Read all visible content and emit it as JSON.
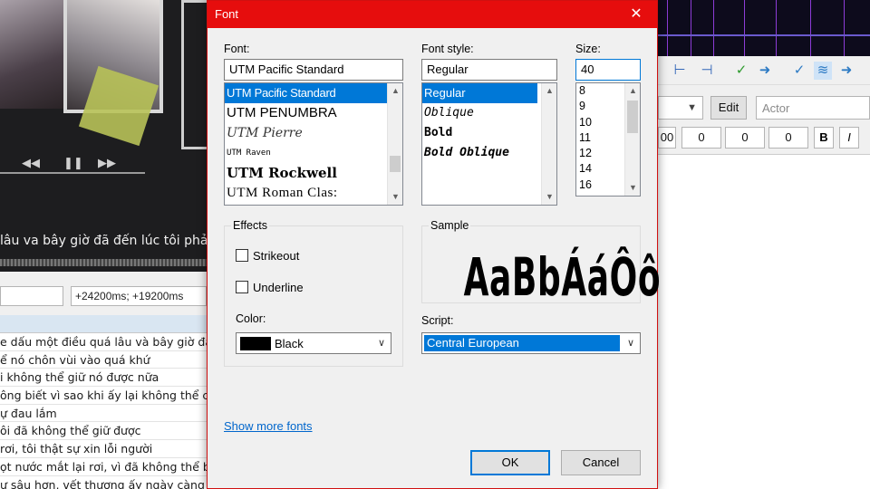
{
  "background": {
    "video_subtitle": "lâu va bây giờ đã đến lúc tôi phải nói",
    "player_controls": [
      "◀◀",
      "❚❚",
      "▶▶"
    ],
    "time_field": "+24200ms; +19200ms",
    "grid_rows": [
      "e dấu một điều quá lâu và bây giờ đã đến.",
      "ể nó chôn vùi vào quá khứ",
      "i không thể giữ nó được nữa",
      "ông biết vì sao khi ấy lại không thể cất lời",
      "ự đau lắm",
      "ôi đã không thể giữ được",
      "rơi, tôi thật sự xin lỗi người",
      "ọt nước mắt lại rơi, vì đã không thể bảo vệ",
      "ự sâu hơn, vết thương ấy ngày càng sâu"
    ],
    "edit_button": "Edit",
    "actor_placeholder": "Actor",
    "margins": [
      "00",
      "0",
      "0",
      "0"
    ],
    "format_buttons": [
      "B",
      "I"
    ]
  },
  "dialog": {
    "title": "Font",
    "font_label": "Font:",
    "font_value": "UTM Pacific Standard",
    "font_list": [
      "UTM Pacific Standard",
      "UTM PENUMBRA",
      "UTM Pierre",
      "UTM Raven",
      "UTM Rockwell",
      "UTM Roman Clas:"
    ],
    "style_label": "Font style:",
    "style_value": "Regular",
    "style_list": [
      "Regular",
      "Oblique",
      "Bold",
      "Bold Oblique"
    ],
    "size_label": "Size:",
    "size_value": "40",
    "size_list": [
      "8",
      "9",
      "10",
      "11",
      "12",
      "14",
      "16"
    ],
    "effects_label": "Effects",
    "strikeout_label": "Strikeout",
    "underline_label": "Underline",
    "color_label": "Color:",
    "color_value": "Black",
    "sample_label": "Sample",
    "sample_text": "AaBbÁáÔô",
    "script_label": "Script:",
    "script_value": "Central European",
    "show_more_fonts": "Show more fonts",
    "ok_label": "OK",
    "cancel_label": "Cancel"
  },
  "colors": {
    "titlebar": "#e60d0d",
    "selection": "#0078d7",
    "link": "#0066cc"
  }
}
